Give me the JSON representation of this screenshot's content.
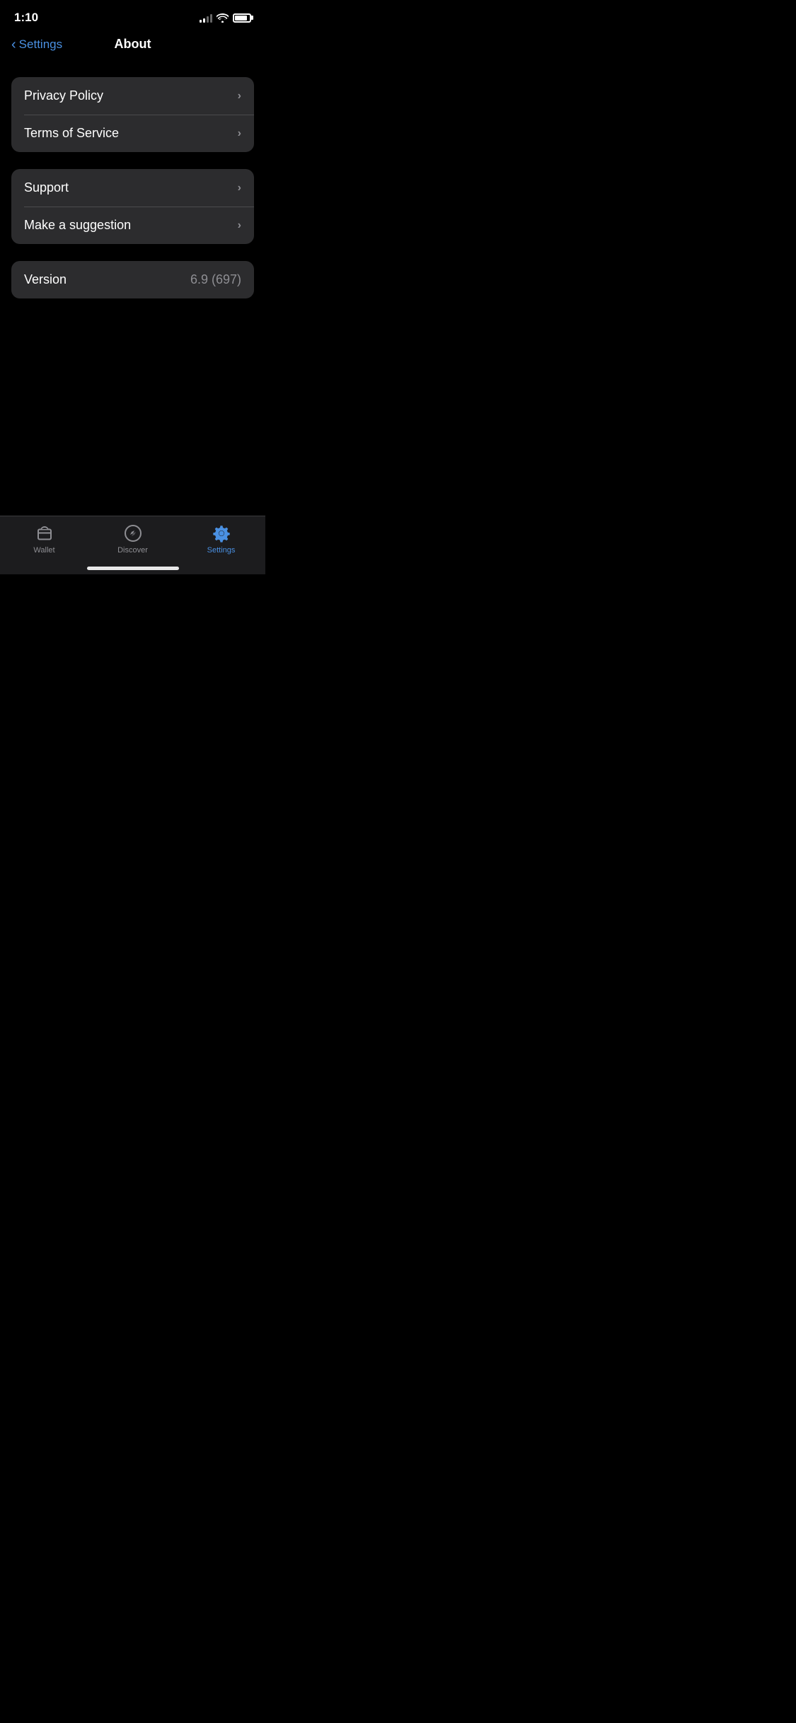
{
  "status_bar": {
    "time": "1:10",
    "signal_bars": [
      4,
      6,
      8,
      11,
      14
    ],
    "signal_active": 2
  },
  "nav": {
    "back_label": "Settings",
    "title": "About"
  },
  "groups": [
    {
      "id": "legal",
      "items": [
        {
          "id": "privacy-policy",
          "label": "Privacy Policy",
          "value": "",
          "has_chevron": true
        },
        {
          "id": "terms-of-service",
          "label": "Terms of Service",
          "value": "",
          "has_chevron": true
        }
      ]
    },
    {
      "id": "support",
      "items": [
        {
          "id": "support",
          "label": "Support",
          "value": "",
          "has_chevron": true
        },
        {
          "id": "suggestion",
          "label": "Make a suggestion",
          "value": "",
          "has_chevron": true
        }
      ]
    },
    {
      "id": "version",
      "items": [
        {
          "id": "version",
          "label": "Version",
          "value": "6.9 (697)",
          "has_chevron": false
        }
      ]
    }
  ],
  "tab_bar": {
    "items": [
      {
        "id": "wallet",
        "label": "Wallet",
        "active": false
      },
      {
        "id": "discover",
        "label": "Discover",
        "active": false
      },
      {
        "id": "settings",
        "label": "Settings",
        "active": true
      }
    ]
  }
}
